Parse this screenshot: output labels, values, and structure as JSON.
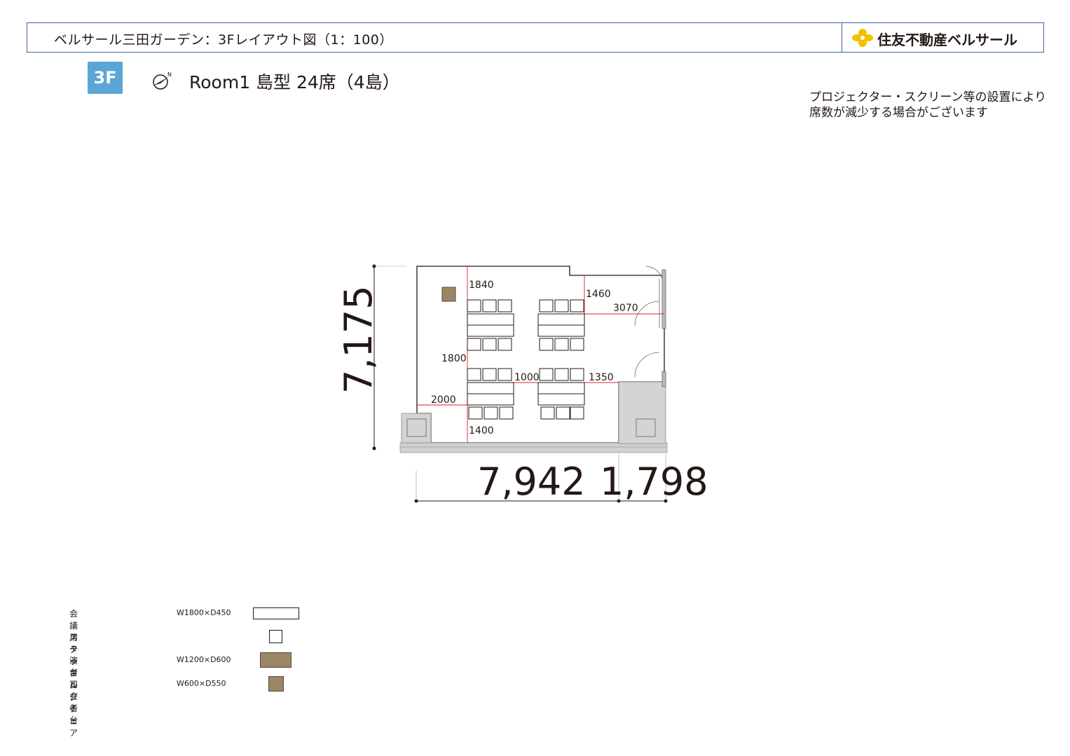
{
  "header": {
    "title": "ベルサール三田ガーデン：3Fレイアウト図（1：100）",
    "logo_text": "住友不動産ベルサール"
  },
  "floor_badge": "3F",
  "room_title": "Room1 島型 24席（4島）",
  "note": {
    "line1": "プロジェクター・スクリーン等の設置により",
    "line2": "席数が減少する場合がございます"
  },
  "compass": {
    "label": "N"
  },
  "dimensions": {
    "height": "7,175",
    "width_main": "7,942",
    "width_side": "1,798"
  },
  "plan_labels": {
    "d1840": "1840",
    "d1460": "1460",
    "d3070": "3070",
    "d1800": "1800",
    "d1000": "1000",
    "d1350": "1350",
    "d2000": "2000",
    "d1400": "1400"
  },
  "legend": [
    {
      "label": "会議用テーブル",
      "size": "W1800×D450"
    },
    {
      "label": "スタッキングチェア",
      "size": ""
    },
    {
      "label": "演台",
      "size": "W1200×D600"
    },
    {
      "label": "司会者台",
      "size": "W600×D550"
    }
  ],
  "colors": {
    "frame": "#3f63a8",
    "badge": "#5aa6d6",
    "dimension_red": "#d9232e",
    "podium": "#9c8466",
    "logo_yellow": "#f2c200",
    "wall_gray": "#c8c8c8"
  }
}
